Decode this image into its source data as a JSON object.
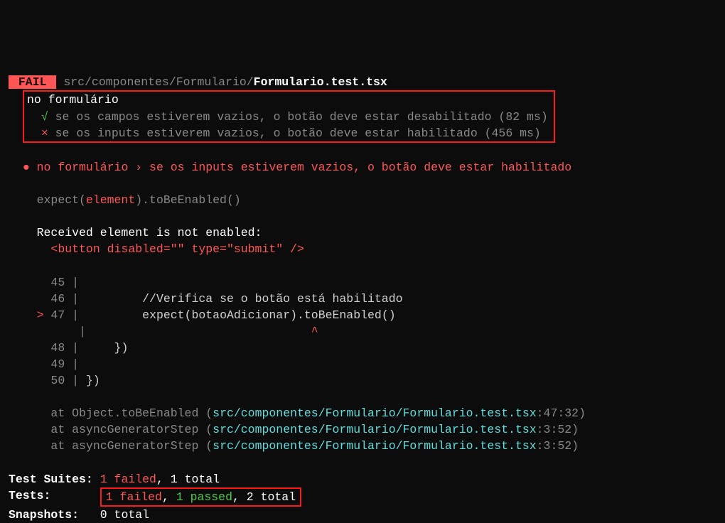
{
  "header": {
    "fail_label": " FAIL ",
    "path_dim": "src/componentes/Formulario/",
    "path_file": "Formulario.test.tsx"
  },
  "suite": {
    "describe": "no formulário",
    "pass_mark": "√",
    "pass_text": " se os campos estiverem vazios, o botão deve estar desabilitado (82 ms)",
    "fail_mark": "×",
    "fail_text": " se os inputs estiverem vazios, o botão deve estar habilitado (456 ms)"
  },
  "failure": {
    "bullet": "●",
    "title": " no formulário › se os inputs estiverem vazios, o botão deve estar habilitado",
    "expect_prefix": "expect(",
    "expect_elem": "element",
    "expect_suffix": ").toBeEnabled()",
    "received_msg": "Received element is not enabled:",
    "received_html": "  <button disabled=\"\" type=\"submit\" />"
  },
  "code": {
    "l45_num": "  45",
    "l45_bar": " |",
    "l46_num": "  46",
    "l46_bar": " |",
    "l46_code": "         //Verifica se o botão está habilitado",
    "pointer": ">",
    "l47_num": " 47",
    "l47_bar": " |",
    "l47_code": "         expect(botaoAdicionar).toBeEnabled()",
    "caret_num": "    ",
    "caret_bar": " |",
    "caret_mark": "                                ^",
    "l48_num": "  48",
    "l48_bar": " |",
    "l48_code": "     })",
    "l49_num": "  49",
    "l49_bar": " |",
    "l50_num": "  50",
    "l50_bar": " |",
    "l50_code": " })"
  },
  "stack": {
    "s1_prefix": "at Object.toBeEnabled (",
    "s1_path": "src/componentes/Formulario/Formulario.test.tsx",
    "s1_loc": ":47:32)",
    "s2_prefix": "at asyncGeneratorStep (",
    "s2_path": "src/componentes/Formulario/Formulario.test.tsx",
    "s2_loc": ":3:52)",
    "s3_prefix": "at asyncGeneratorStep (",
    "s3_path": "src/componentes/Formulario/Formulario.test.tsx",
    "s3_loc": ":3:52)"
  },
  "summary": {
    "suites_label": "Test Suites: ",
    "suites_failed": "1 failed",
    "suites_sep": ", ",
    "suites_total": "1 total",
    "tests_label": "Tests:       ",
    "tests_failed": "1 failed",
    "tests_sep1": ", ",
    "tests_passed": "1 passed",
    "tests_sep2": ", ",
    "tests_total": "2 total",
    "snapshots_label": "Snapshots:   ",
    "snapshots_total": "0 total"
  }
}
